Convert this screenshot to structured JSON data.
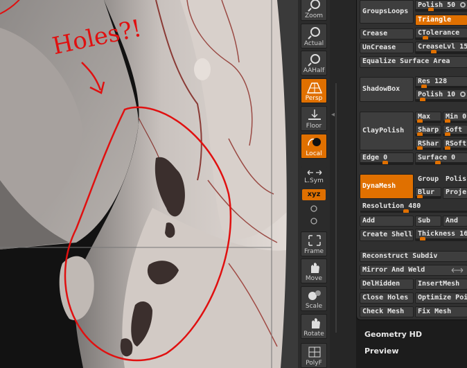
{
  "viewport": {
    "annotation_text": "Holes?!",
    "annotation_color": "#e01010"
  },
  "toolbar": {
    "buttons": [
      {
        "label": "Zoom",
        "icon": "zoom-icon",
        "active": false
      },
      {
        "label": "Actual",
        "icon": "magnifier-icon",
        "active": false
      },
      {
        "label": "AAHalf",
        "icon": "magnifier-icon",
        "active": false
      },
      {
        "label": "Persp",
        "icon": "perspective-grid-icon",
        "active": true
      },
      {
        "label": "Floor",
        "icon": "floor-icon",
        "active": false
      },
      {
        "label": "Local",
        "icon": "local-rotate-icon",
        "active": true
      },
      {
        "label": "L.Sym",
        "icon": "symmetry-icon",
        "active": false
      },
      {
        "label": "Frame",
        "icon": "frame-icon",
        "active": false
      },
      {
        "label": "Move",
        "icon": "move-hand-icon",
        "active": false
      },
      {
        "label": "Scale",
        "icon": "scale-icon",
        "active": false
      },
      {
        "label": "Rotate",
        "icon": "rotate-icon",
        "active": false
      },
      {
        "label": "PolyF",
        "icon": "polyframe-icon",
        "active": false
      }
    ],
    "xyz_label": "xyz"
  },
  "panel": {
    "groups_loops": "GroupsLoops",
    "polish": "Polish 50",
    "triangle": "Triangle",
    "crease": "Crease",
    "ctolerance": "CTolerance",
    "uncrease": "UnCrease",
    "creaselvl": "CreaseLvl 15",
    "equalize": "Equalize Surface Area",
    "shadowbox": "ShadowBox",
    "res": "Res 128",
    "polish10": "Polish 10",
    "claypolish": "ClayPolish",
    "max": "Max",
    "min": "Min 0",
    "sharp": "Sharp",
    "soft": "Soft",
    "rshar": "RShar",
    "rsoft": "RSoft",
    "edge": "Edge 0",
    "surface": "Surface 0",
    "dynamesh": "DynaMesh",
    "group": "Group",
    "polish2": "Polish",
    "blur": "Blur",
    "project": "Projec",
    "resolution": "Resolution 480",
    "add": "Add",
    "sub": "Sub",
    "and": "And",
    "create_shell": "Create Shell",
    "thickness": "Thickness 16",
    "reconstruct": "Reconstruct Subdiv",
    "mirror_weld": "Mirror And Weld",
    "delhidden": "DelHidden",
    "insertmesh": "InsertMesh",
    "close_holes": "Close Holes",
    "optimize": "Optimize Poi",
    "check_mesh": "Check Mesh",
    "fix_mesh": "Fix Mesh"
  },
  "sections": {
    "geometry_hd": "Geometry HD",
    "preview": "Preview"
  },
  "colors": {
    "accent": "#e07000",
    "panel_bg": "#303030",
    "button_bg": "#3e3e3e"
  }
}
